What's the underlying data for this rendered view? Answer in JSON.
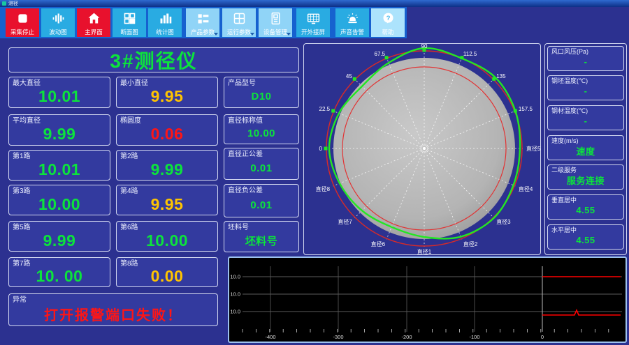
{
  "window": {
    "title": "测径"
  },
  "toolbar": {
    "buttons": [
      {
        "label": "采集停止",
        "icon": "stop-icon",
        "style": "red"
      },
      {
        "label": "波动图",
        "icon": "waveform-icon",
        "style": "blue"
      },
      {
        "label": "主界面",
        "icon": "home-icon",
        "style": "red"
      },
      {
        "label": "断面图",
        "icon": "section-icon",
        "style": "blue"
      },
      {
        "label": "统计图",
        "icon": "barchart-icon",
        "style": "blue"
      },
      {
        "label": "产品参数",
        "icon": "product-params-icon",
        "style": "light",
        "dropdown": true
      },
      {
        "label": "运行参数",
        "icon": "run-params-icon",
        "style": "light",
        "dropdown": true
      },
      {
        "label": "设备管理",
        "icon": "device-icon",
        "style": "light",
        "dropdown": true
      },
      {
        "label": "开外接屏",
        "icon": "monitor-icon",
        "style": "blue"
      },
      {
        "label": "声音告警",
        "icon": "siren-icon",
        "style": "blue"
      },
      {
        "label": "帮助",
        "icon": "help-icon",
        "style": "lighter"
      }
    ]
  },
  "gauge": {
    "title": "3#测径仪",
    "cells": [
      {
        "label": "最大直径",
        "value": "10.01",
        "color": "green"
      },
      {
        "label": "最小直径",
        "value": "9.95",
        "color": "yellow"
      },
      {
        "label": "平均直径",
        "value": "9.99",
        "color": "green"
      },
      {
        "label": "椭圆度",
        "value": "0.06",
        "color": "red"
      },
      {
        "label": "第1路",
        "value": "10.01",
        "color": "green"
      },
      {
        "label": "第2路",
        "value": "9.99",
        "color": "green"
      },
      {
        "label": "第3路",
        "value": "10.00",
        "color": "green"
      },
      {
        "label": "第4路",
        "value": "9.95",
        "color": "yellow"
      },
      {
        "label": "第5路",
        "value": "9.99",
        "color": "green"
      },
      {
        "label": "第6路",
        "value": "10.00",
        "color": "green"
      },
      {
        "label": "第7路",
        "value": "10. 00",
        "color": "green"
      },
      {
        "label": "第8路",
        "value": "0.00",
        "color": "yellow"
      }
    ],
    "specs": [
      {
        "label": "产品型号",
        "value": "D10",
        "color": "green"
      },
      {
        "label": "直径标称值",
        "value": "10.00",
        "color": "green"
      },
      {
        "label": "直径正公差",
        "value": "0.01",
        "color": "green"
      },
      {
        "label": "直径负公差",
        "value": "0.01",
        "color": "green"
      },
      {
        "label": "坯料号",
        "value": "坯料号",
        "color": "green"
      }
    ],
    "exception": {
      "label": "异常",
      "value": "打开报警端口失败！",
      "color": "red"
    }
  },
  "right_panel": {
    "boxes": [
      {
        "label": "风口风压(Pa)",
        "value": "-",
        "color": "green"
      },
      {
        "label": "钢坯温度(℃)",
        "value": "-",
        "color": "green"
      },
      {
        "label": "钢材温度(℃)",
        "value": "-",
        "color": "green"
      },
      {
        "label": "速度(m/s)",
        "value": "速度",
        "color": "green"
      },
      {
        "label": "二级服务",
        "value": "服务连接",
        "color": "green"
      },
      {
        "label": "垂直居中",
        "value": "4.55",
        "color": "green"
      },
      {
        "label": "水平居中",
        "value": "4.55",
        "color": "green"
      }
    ]
  },
  "charts": {
    "polar": {
      "type": "polar-profile",
      "base_radius": 130,
      "outer_tolerance_radius": 140,
      "inner_tolerance_radius": 117,
      "angle_step_deg": 22.5,
      "angle_labels": [
        {
          "deg": 180,
          "text": "0",
          "marker": true
        },
        {
          "deg": 157.5,
          "text": "22.5",
          "marker": true
        },
        {
          "deg": 135,
          "text": "45",
          "marker": true
        },
        {
          "deg": 112.5,
          "text": "67.5",
          "marker": true
        },
        {
          "deg": 90,
          "text": "90",
          "marker": true
        },
        {
          "deg": 67.5,
          "text": "112.5",
          "marker": true
        },
        {
          "deg": 45,
          "text": "135",
          "marker": true
        },
        {
          "deg": 22.5,
          "text": "157.5",
          "marker": true
        },
        {
          "deg": 0,
          "text": "直径5",
          "marker": false
        },
        {
          "deg": -22.5,
          "text": "直径4",
          "marker": false
        },
        {
          "deg": -45,
          "text": "直径3",
          "marker": false
        },
        {
          "deg": -67.5,
          "text": "直径2",
          "marker": false
        },
        {
          "deg": -90,
          "text": "直径1",
          "marker": false
        },
        {
          "deg": -112.5,
          "text": "直径6",
          "marker": false
        },
        {
          "deg": -135,
          "text": "直径7",
          "marker": false
        },
        {
          "deg": -157.5,
          "text": "直径8",
          "marker": false
        }
      ],
      "profile_radii": [
        137,
        141,
        144,
        140,
        144,
        133,
        126,
        132,
        136,
        131,
        126,
        122,
        127,
        137,
        141,
        138
      ],
      "colors": {
        "body": "#b6b6b6",
        "tolerance": "#d42a2a",
        "profile": "#23e723",
        "spokes": "#ffffff"
      }
    },
    "trend": {
      "type": "line",
      "x_ticks": [
        "-400",
        "-300",
        "-200",
        "-100",
        "0"
      ],
      "y_ticks": [
        "10.0",
        "10.0",
        "10.0"
      ],
      "zero_line_x_tick": "0",
      "red_traces": [
        {
          "grid_row": 0,
          "spike": false
        },
        {
          "grid_row": 2,
          "spike": true
        }
      ],
      "colors": {
        "trace": "#ff0000",
        "grid": "#4a4a4a",
        "axis_text": "#dddddd",
        "background": "#000000"
      }
    }
  }
}
